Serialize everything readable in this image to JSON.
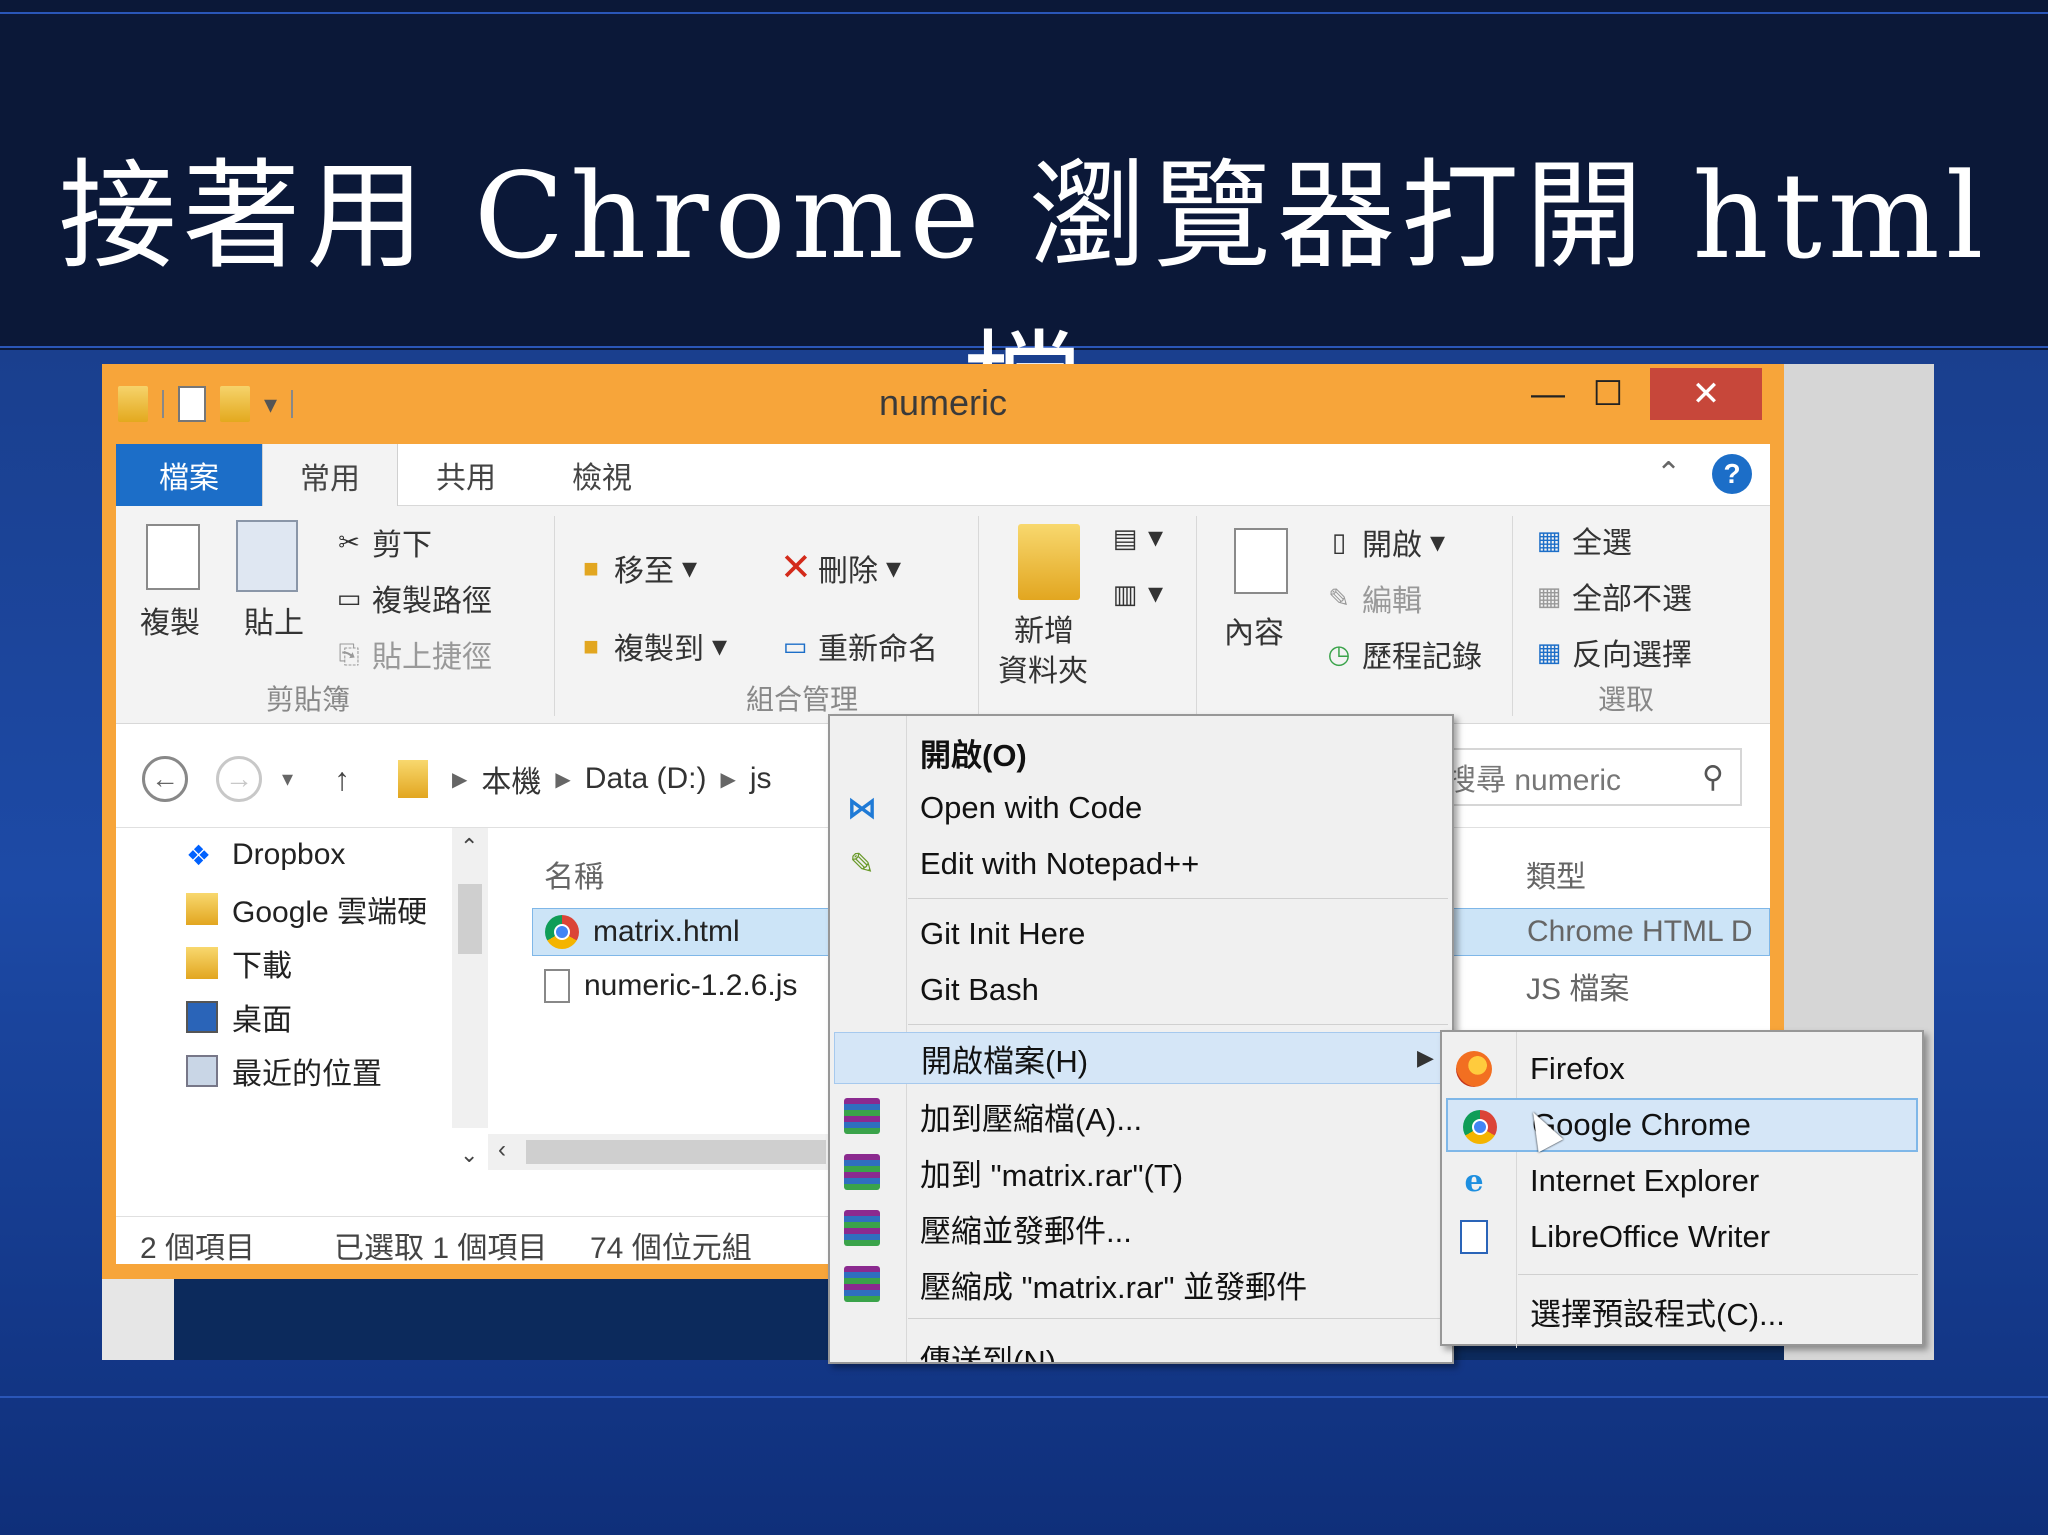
{
  "slide": {
    "title": "接著用 Chrome 瀏覽器打開 html 檔"
  },
  "window": {
    "title": "numeric",
    "min_glyph": "—",
    "max_glyph": "☐",
    "close_glyph": "✕"
  },
  "ribbon": {
    "tabs": [
      "檔案",
      "常用",
      "共用",
      "檢視"
    ],
    "clipboard": {
      "copy": "複製",
      "paste": "貼上",
      "cut": "剪下",
      "copy_path": "複製路徑",
      "paste_shortcut": "貼上捷徑",
      "label": "剪貼簿"
    },
    "organize": {
      "move_to": "移至",
      "copy_to": "複製到",
      "delete": "刪除",
      "rename": "重新命名",
      "label": "組合管理"
    },
    "new": {
      "new_folder_line1": "新增",
      "new_folder_line2": "資料夾"
    },
    "open": {
      "properties": "內容",
      "open": "開啟",
      "edit": "編輯",
      "history": "歷程記錄"
    },
    "select": {
      "select_all": "全選",
      "select_none": "全部不選",
      "invert": "反向選擇",
      "label": "選取"
    }
  },
  "address": {
    "crumbs": [
      "本機",
      "Data (D:)",
      "js"
    ],
    "search_placeholder": "搜尋 numeric"
  },
  "nav_pane": {
    "items": [
      "Dropbox",
      "Google 雲端硬",
      "下載",
      "桌面",
      "最近的位置"
    ]
  },
  "file_list": {
    "col_name": "名稱",
    "col_type": "類型",
    "files": [
      {
        "name": "matrix.html",
        "type": "Chrome HTML D"
      },
      {
        "name": "numeric-1.2.6.js",
        "type": "JS 檔案"
      }
    ]
  },
  "status": {
    "count": "2 個項目",
    "selected": "已選取 1 個項目",
    "size": "74 個位元組"
  },
  "context_menu": {
    "items": [
      {
        "label": "開啟(O)",
        "icon": "none"
      },
      {
        "label": "Open with Code",
        "icon": "vscode-icon"
      },
      {
        "label": "Edit with Notepad++",
        "icon": "notepad-plus-plus-icon"
      },
      {
        "label": "Git Init Here",
        "icon": "none"
      },
      {
        "label": "Git Bash",
        "icon": "none"
      },
      {
        "label": "開啟檔案(H)",
        "icon": "none"
      },
      {
        "label": "加到壓縮檔(A)...",
        "icon": "winrar-icon"
      },
      {
        "label": "加到 \"matrix.rar\"(T)",
        "icon": "winrar-icon"
      },
      {
        "label": "壓縮並發郵件...",
        "icon": "winrar-icon"
      },
      {
        "label": "壓縮成 \"matrix.rar\" 並發郵件",
        "icon": "winrar-icon"
      },
      {
        "label": "傳送到(N)",
        "icon": "none"
      }
    ]
  },
  "open_with_menu": {
    "items": [
      {
        "label": "Firefox",
        "icon": "firefox-icon"
      },
      {
        "label": "Google Chrome",
        "icon": "chrome-icon"
      },
      {
        "label": "Internet Explorer",
        "icon": "ie-icon"
      },
      {
        "label": "LibreOffice Writer",
        "icon": "libreoffice-writer-icon"
      },
      {
        "label": "選擇預設程式(C)...",
        "icon": "none"
      }
    ]
  },
  "colors": {
    "window_frame": "#f7a53a",
    "file_tab": "#1c6ec8",
    "close_button": "#c7473a",
    "highlight": "#d5e6f7"
  }
}
